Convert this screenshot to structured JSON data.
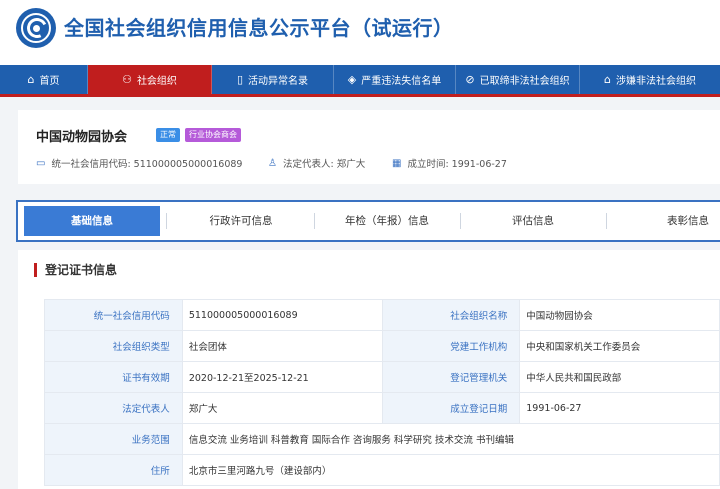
{
  "header": {
    "title": "全国社会组织信用信息公示平台（试运行）",
    "brand_color": "#1f5fae"
  },
  "nav": {
    "items": [
      {
        "icon": "home-icon",
        "glyph": "⌂",
        "label": "首页",
        "active": false
      },
      {
        "icon": "org-tree-icon",
        "glyph": "⚇",
        "label": "社会组织",
        "active": true
      },
      {
        "icon": "document-icon",
        "glyph": "▯",
        "label": "活动异常名录",
        "active": false
      },
      {
        "icon": "shield-icon",
        "glyph": "◈",
        "label": "严重违法失信名单",
        "active": false
      },
      {
        "icon": "ban-icon",
        "glyph": "⊘",
        "label": "已取缔非法社会组织",
        "active": false
      },
      {
        "icon": "alarm-icon",
        "glyph": "⌂",
        "label": "涉嫌非法社会组织",
        "active": false
      }
    ],
    "accent_color": "#c01e1e"
  },
  "org": {
    "name": "中国动物园协会",
    "status_badge": "正常",
    "type_badge": "行业协会商会",
    "credit_code_label": "统一社会信用代码: 511000005000016089",
    "legal_rep_label": "法定代表人: 郑广大",
    "founded_label": "成立时间: 1991-06-27"
  },
  "tabs": [
    {
      "label": "基础信息",
      "active": true
    },
    {
      "label": "行政许可信息",
      "active": false
    },
    {
      "label": "年检（年报）信息",
      "active": false
    },
    {
      "label": "评估信息",
      "active": false
    },
    {
      "label": "表彰信息",
      "active": false
    }
  ],
  "section": {
    "title": "登记证书信息",
    "rows": [
      {
        "l1": "统一社会信用代码",
        "v1": "511000005000016089",
        "l2": "社会组织名称",
        "v2": "中国动物园协会"
      },
      {
        "l1": "社会组织类型",
        "v1": "社会团体",
        "l2": "党建工作机构",
        "v2": "中央和国家机关工作委员会"
      },
      {
        "l1": "证书有效期",
        "v1": "2020-12-21至2025-12-21",
        "l2": "登记管理机关",
        "v2": "中华人民共和国民政部"
      },
      {
        "l1": "法定代表人",
        "v1": "郑广大",
        "l2": "成立登记日期",
        "v2": "1991-06-27"
      }
    ],
    "scope_label": "业务范围",
    "scope_value": "信息交流 业务培训 科普教育 国际合作 咨询服务 科学研究 技术交流 书刊编辑",
    "address_label": "住所",
    "address_value": "北京市三里河路九号（建设部内）"
  }
}
